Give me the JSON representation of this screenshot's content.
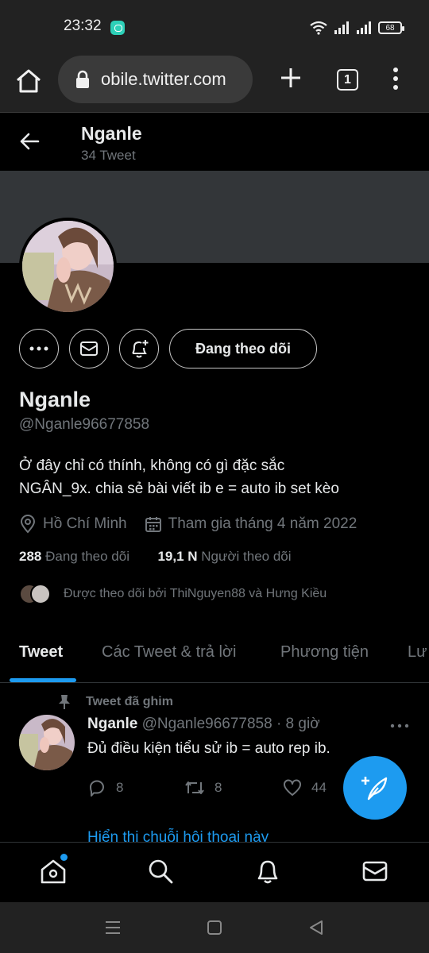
{
  "status_bar": {
    "time": "23:32",
    "battery": "68",
    "icons": [
      "messenger-icon",
      "wifi-icon",
      "signal-icon",
      "signal-icon",
      "battery-icon"
    ]
  },
  "browser": {
    "url": "obile.twitter.com",
    "tab_count": "1"
  },
  "header": {
    "name": "Nganle",
    "tweet_count": "34 Tweet"
  },
  "profile": {
    "follow_button": "Đang theo dõi",
    "display_name": "Nganle",
    "handle": "@Nganle96677858",
    "bio_lines": [
      "Ở đây chỉ có thính, không có gì đặc sắc",
      "NGÂN_9x. chia sẻ bài viết ib e = auto ib set kèo"
    ],
    "location": "Hồ Chí Minh",
    "joined": "Tham gia tháng 4 năm 2022",
    "following_count": "288",
    "following_label": "Đang theo dõi",
    "followers_count": "19,1 N",
    "followers_label": "Người theo dõi",
    "followed_by": "Được theo dõi bởi ThiNguyen88 và Hưng Kiều"
  },
  "tabs": [
    {
      "label": "Tweet",
      "active": true
    },
    {
      "label": "Các Tweet & trả lời",
      "active": false
    },
    {
      "label": "Phương tiện",
      "active": false
    },
    {
      "label": "Lư",
      "active": false
    }
  ],
  "pinned_tweet": {
    "pinned_label": "Tweet đã ghim",
    "name": "Nganle",
    "handle_time": "@Nganle96677858 · 8 giờ",
    "text": "Đủ điều kiện tiểu sử ib = auto rep ib.",
    "replies": "8",
    "retweets": "8",
    "likes": "44",
    "show_thread": "Hiển thị chuỗi hội thoại này"
  },
  "colors": {
    "accent": "#1d9bf0",
    "background": "#000000",
    "banner": "#333639",
    "muted_text": "#71767b"
  }
}
